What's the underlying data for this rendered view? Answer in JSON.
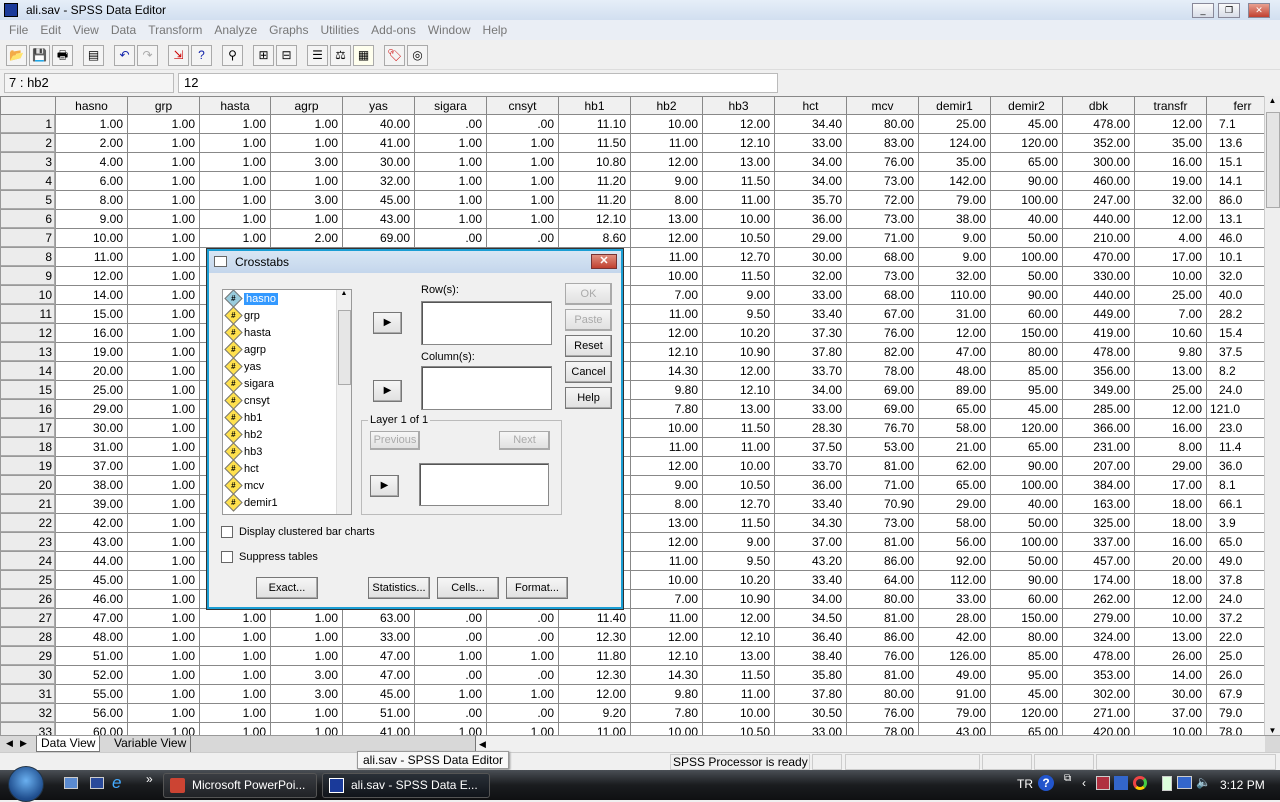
{
  "window": {
    "title": "ali.sav - SPSS Data Editor",
    "app_icon_text": "SPSS"
  },
  "menu": [
    "File",
    "Edit",
    "View",
    "Data",
    "Transform",
    "Analyze",
    "Graphs",
    "Utilities",
    "Add-ons",
    "Window",
    "Help"
  ],
  "toolbar": [
    "open-icon",
    "save-icon",
    "print-icon",
    "dialog-recall-icon",
    "undo-icon",
    "redo-icon",
    "goto-case-icon",
    "variables-icon",
    "find-icon",
    "insert-cases-icon",
    "insert-variable-icon",
    "split-file-icon",
    "weight-cases-icon",
    "select-cases-icon",
    "value-labels-icon",
    "use-sets-icon"
  ],
  "cell_editor": {
    "ref": "7 : hb2",
    "value": "12"
  },
  "grid": {
    "columns": [
      "hasno",
      "grp",
      "hasta",
      "agrp",
      "yas",
      "sigara",
      "cnsyt",
      "hb1",
      "hb2",
      "hb3",
      "hct",
      "mcv",
      "demir1",
      "demir2",
      "dbk",
      "transfr",
      "ferr"
    ],
    "rows": [
      [
        "1",
        "1.00",
        "1.00",
        "1.00",
        "1.00",
        "40.00",
        ".00",
        ".00",
        "11.10",
        "10.00",
        "12.00",
        "34.40",
        "80.00",
        "25.00",
        "45.00",
        "478.00",
        "12.00",
        "7.1"
      ],
      [
        "2",
        "2.00",
        "1.00",
        "1.00",
        "1.00",
        "41.00",
        "1.00",
        "1.00",
        "11.50",
        "11.00",
        "12.10",
        "33.00",
        "83.00",
        "124.00",
        "120.00",
        "352.00",
        "35.00",
        "13.6"
      ],
      [
        "3",
        "4.00",
        "1.00",
        "1.00",
        "3.00",
        "30.00",
        "1.00",
        "1.00",
        "10.80",
        "12.00",
        "13.00",
        "34.00",
        "76.00",
        "35.00",
        "65.00",
        "300.00",
        "16.00",
        "15.1"
      ],
      [
        "4",
        "6.00",
        "1.00",
        "1.00",
        "1.00",
        "32.00",
        "1.00",
        "1.00",
        "11.20",
        "9.00",
        "11.50",
        "34.00",
        "73.00",
        "142.00",
        "90.00",
        "460.00",
        "19.00",
        "14.1"
      ],
      [
        "5",
        "8.00",
        "1.00",
        "1.00",
        "3.00",
        "45.00",
        "1.00",
        "1.00",
        "11.20",
        "8.00",
        "11.00",
        "35.70",
        "72.00",
        "79.00",
        "100.00",
        "247.00",
        "32.00",
        "86.0"
      ],
      [
        "6",
        "9.00",
        "1.00",
        "1.00",
        "1.00",
        "43.00",
        "1.00",
        "1.00",
        "12.10",
        "13.00",
        "10.00",
        "36.00",
        "73.00",
        "38.00",
        "40.00",
        "440.00",
        "12.00",
        "13.1"
      ],
      [
        "7",
        "10.00",
        "1.00",
        "1.00",
        "2.00",
        "69.00",
        ".00",
        ".00",
        "8.60",
        "12.00",
        "10.50",
        "29.00",
        "71.00",
        "9.00",
        "50.00",
        "210.00",
        "4.00",
        "46.0"
      ],
      [
        "8",
        "11.00",
        "1.00",
        "",
        "",
        "",
        "",
        "",
        "",
        "11.00",
        "12.70",
        "30.00",
        "68.00",
        "9.00",
        "100.00",
        "470.00",
        "17.00",
        "10.1"
      ],
      [
        "9",
        "12.00",
        "1.00",
        "",
        "",
        "",
        "",
        "",
        "",
        "10.00",
        "11.50",
        "32.00",
        "73.00",
        "32.00",
        "50.00",
        "330.00",
        "10.00",
        "32.0"
      ],
      [
        "10",
        "14.00",
        "1.00",
        "",
        "",
        "",
        "",
        "",
        "",
        "7.00",
        "9.00",
        "33.00",
        "68.00",
        "110.00",
        "90.00",
        "440.00",
        "25.00",
        "40.0"
      ],
      [
        "11",
        "15.00",
        "1.00",
        "",
        "",
        "",
        "",
        "",
        "",
        "11.00",
        "9.50",
        "33.40",
        "67.00",
        "31.00",
        "60.00",
        "449.00",
        "7.00",
        "28.2"
      ],
      [
        "12",
        "16.00",
        "1.00",
        "",
        "",
        "",
        "",
        "",
        "",
        "12.00",
        "10.20",
        "37.30",
        "76.00",
        "12.00",
        "150.00",
        "419.00",
        "10.60",
        "15.4"
      ],
      [
        "13",
        "19.00",
        "1.00",
        "",
        "",
        "",
        "",
        "",
        "",
        "12.10",
        "10.90",
        "37.80",
        "82.00",
        "47.00",
        "80.00",
        "478.00",
        "9.80",
        "37.5"
      ],
      [
        "14",
        "20.00",
        "1.00",
        "",
        "",
        "",
        "",
        "",
        "",
        "14.30",
        "12.00",
        "33.70",
        "78.00",
        "48.00",
        "85.00",
        "356.00",
        "13.00",
        "8.2"
      ],
      [
        "15",
        "25.00",
        "1.00",
        "",
        "",
        "",
        "",
        "",
        "",
        "9.80",
        "12.10",
        "34.00",
        "69.00",
        "89.00",
        "95.00",
        "349.00",
        "25.00",
        "24.0"
      ],
      [
        "16",
        "29.00",
        "1.00",
        "",
        "",
        "",
        "",
        "",
        "",
        "7.80",
        "13.00",
        "33.00",
        "69.00",
        "65.00",
        "45.00",
        "285.00",
        "12.00",
        "121.0"
      ],
      [
        "17",
        "30.00",
        "1.00",
        "",
        "",
        "",
        "",
        "",
        "",
        "10.00",
        "11.50",
        "28.30",
        "76.70",
        "58.00",
        "120.00",
        "366.00",
        "16.00",
        "23.0"
      ],
      [
        "18",
        "31.00",
        "1.00",
        "",
        "",
        "",
        "",
        "",
        "",
        "11.00",
        "11.00",
        "37.50",
        "53.00",
        "21.00",
        "65.00",
        "231.00",
        "8.00",
        "11.4"
      ],
      [
        "19",
        "37.00",
        "1.00",
        "",
        "",
        "",
        "",
        "",
        "",
        "12.00",
        "10.00",
        "33.70",
        "81.00",
        "62.00",
        "90.00",
        "207.00",
        "29.00",
        "36.0"
      ],
      [
        "20",
        "38.00",
        "1.00",
        "",
        "",
        "",
        "",
        "",
        "",
        "9.00",
        "10.50",
        "36.00",
        "71.00",
        "65.00",
        "100.00",
        "384.00",
        "17.00",
        "8.1"
      ],
      [
        "21",
        "39.00",
        "1.00",
        "",
        "",
        "",
        "",
        "",
        "",
        "8.00",
        "12.70",
        "33.40",
        "70.90",
        "29.00",
        "40.00",
        "163.00",
        "18.00",
        "66.1"
      ],
      [
        "22",
        "42.00",
        "1.00",
        "",
        "",
        "",
        "",
        "",
        "",
        "13.00",
        "11.50",
        "34.30",
        "73.00",
        "58.00",
        "50.00",
        "325.00",
        "18.00",
        "3.9"
      ],
      [
        "23",
        "43.00",
        "1.00",
        "",
        "",
        "",
        "",
        "",
        "",
        "12.00",
        "9.00",
        "37.00",
        "81.00",
        "56.00",
        "100.00",
        "337.00",
        "16.00",
        "65.0"
      ],
      [
        "24",
        "44.00",
        "1.00",
        "",
        "",
        "",
        "",
        "",
        "",
        "11.00",
        "9.50",
        "43.20",
        "86.00",
        "92.00",
        "50.00",
        "457.00",
        "20.00",
        "49.0"
      ],
      [
        "25",
        "45.00",
        "1.00",
        "",
        "",
        "",
        "",
        "",
        "",
        "10.00",
        "10.20",
        "33.40",
        "64.00",
        "112.00",
        "90.00",
        "174.00",
        "18.00",
        "37.8"
      ],
      [
        "26",
        "46.00",
        "1.00",
        "",
        "",
        "",
        "",
        "",
        "",
        "7.00",
        "10.90",
        "34.00",
        "80.00",
        "33.00",
        "60.00",
        "262.00",
        "12.00",
        "24.0"
      ],
      [
        "27",
        "47.00",
        "1.00",
        "1.00",
        "1.00",
        "63.00",
        ".00",
        ".00",
        "11.40",
        "11.00",
        "12.00",
        "34.50",
        "81.00",
        "28.00",
        "150.00",
        "279.00",
        "10.00",
        "37.2"
      ],
      [
        "28",
        "48.00",
        "1.00",
        "1.00",
        "1.00",
        "33.00",
        ".00",
        ".00",
        "12.30",
        "12.00",
        "12.10",
        "36.40",
        "86.00",
        "42.00",
        "80.00",
        "324.00",
        "13.00",
        "22.0"
      ],
      [
        "29",
        "51.00",
        "1.00",
        "1.00",
        "1.00",
        "47.00",
        "1.00",
        "1.00",
        "11.80",
        "12.10",
        "13.00",
        "38.40",
        "76.00",
        "126.00",
        "85.00",
        "478.00",
        "26.00",
        "25.0"
      ],
      [
        "30",
        "52.00",
        "1.00",
        "1.00",
        "3.00",
        "47.00",
        ".00",
        ".00",
        "12.30",
        "14.30",
        "11.50",
        "35.80",
        "81.00",
        "49.00",
        "95.00",
        "353.00",
        "14.00",
        "26.0"
      ],
      [
        "31",
        "55.00",
        "1.00",
        "1.00",
        "3.00",
        "45.00",
        "1.00",
        "1.00",
        "12.00",
        "9.80",
        "11.00",
        "37.80",
        "80.00",
        "91.00",
        "45.00",
        "302.00",
        "30.00",
        "67.9"
      ],
      [
        "32",
        "56.00",
        "1.00",
        "1.00",
        "1.00",
        "51.00",
        ".00",
        ".00",
        "9.20",
        "7.80",
        "10.00",
        "30.50",
        "76.00",
        "79.00",
        "120.00",
        "271.00",
        "37.00",
        "79.0"
      ],
      [
        "33",
        "60.00",
        "1.00",
        "1.00",
        "1.00",
        "41.00",
        "1.00",
        "1.00",
        "11.00",
        "10.00",
        "10.50",
        "33.00",
        "78.00",
        "43.00",
        "65.00",
        "420.00",
        "10.00",
        "78.0"
      ]
    ]
  },
  "tabs": {
    "data_view": "Data View",
    "variable_view": "Variable View"
  },
  "status": {
    "processor": "SPSS Processor  is ready"
  },
  "tooltip": "ali.sav - SPSS Data Editor",
  "dialog": {
    "title": "Crosstabs",
    "variables": [
      "hasno",
      "grp",
      "hasta",
      "agrp",
      "yas",
      "sigara",
      "cnsyt",
      "hb1",
      "hb2",
      "hb3",
      "hct",
      "mcv",
      "demir1"
    ],
    "selected_variable": "hasno",
    "rows_label": "Row(s):",
    "columns_label": "Column(s):",
    "layer_label": "Layer 1 of 1",
    "previous": "Previous",
    "next": "Next",
    "ok": "OK",
    "paste": "Paste",
    "reset": "Reset",
    "cancel": "Cancel",
    "help": "Help",
    "clustered_bar": "Display clustered bar charts",
    "suppress_tables": "Suppress tables",
    "exact": "Exact...",
    "statistics": "Statistics...",
    "cells": "Cells...",
    "format": "Format..."
  },
  "taskbar": {
    "tasks": [
      "Microsoft PowerPoi...",
      "ali.sav - SPSS Data E..."
    ],
    "language": "TR",
    "clock": "3:12 PM"
  }
}
